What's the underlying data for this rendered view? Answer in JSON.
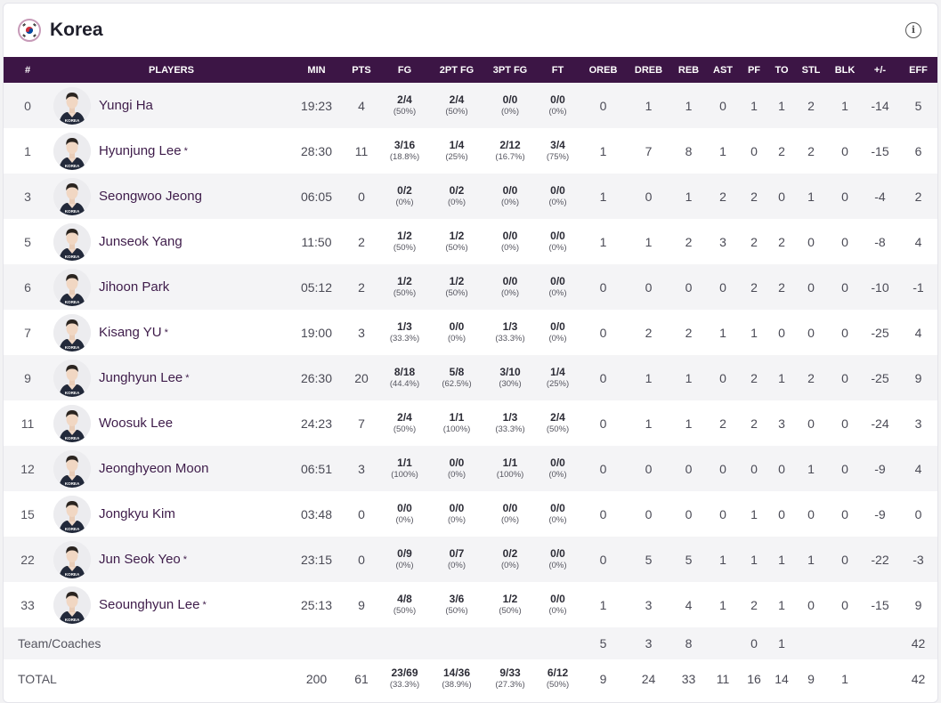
{
  "team": {
    "name": "Korea",
    "flag_icon": "south-korea-flag-icon",
    "info_icon": "info-icon"
  },
  "colors": {
    "header_bg": "#3c1545",
    "player_name": "#3e1c4a",
    "row_alt": "#f4f4f6"
  },
  "columns": [
    "#",
    "PLAYERS",
    "MIN",
    "PTS",
    "FG",
    "2PT FG",
    "3PT FG",
    "FT",
    "OREB",
    "DREB",
    "REB",
    "AST",
    "PF",
    "TO",
    "STL",
    "BLK",
    "+/-",
    "EFF"
  ],
  "players": [
    {
      "num": "0",
      "name": "Yungi Ha",
      "starter": false,
      "min": "19:23",
      "pts": "4",
      "fg": "2/4",
      "fg_pct": "(50%)",
      "p2": "2/4",
      "p2_pct": "(50%)",
      "p3": "0/0",
      "p3_pct": "(0%)",
      "ft": "0/0",
      "ft_pct": "(0%)",
      "oreb": "0",
      "dreb": "1",
      "reb": "1",
      "ast": "0",
      "pf": "1",
      "to": "1",
      "stl": "2",
      "blk": "1",
      "pm": "-14",
      "eff": "5"
    },
    {
      "num": "1",
      "name": "Hyunjung Lee",
      "starter": true,
      "min": "28:30",
      "pts": "11",
      "fg": "3/16",
      "fg_pct": "(18.8%)",
      "p2": "1/4",
      "p2_pct": "(25%)",
      "p3": "2/12",
      "p3_pct": "(16.7%)",
      "ft": "3/4",
      "ft_pct": "(75%)",
      "oreb": "1",
      "dreb": "7",
      "reb": "8",
      "ast": "1",
      "pf": "0",
      "to": "2",
      "stl": "2",
      "blk": "0",
      "pm": "-15",
      "eff": "6"
    },
    {
      "num": "3",
      "name": "Seongwoo Jeong",
      "starter": false,
      "min": "06:05",
      "pts": "0",
      "fg": "0/2",
      "fg_pct": "(0%)",
      "p2": "0/2",
      "p2_pct": "(0%)",
      "p3": "0/0",
      "p3_pct": "(0%)",
      "ft": "0/0",
      "ft_pct": "(0%)",
      "oreb": "1",
      "dreb": "0",
      "reb": "1",
      "ast": "2",
      "pf": "2",
      "to": "0",
      "stl": "1",
      "blk": "0",
      "pm": "-4",
      "eff": "2"
    },
    {
      "num": "5",
      "name": "Junseok Yang",
      "starter": false,
      "min": "11:50",
      "pts": "2",
      "fg": "1/2",
      "fg_pct": "(50%)",
      "p2": "1/2",
      "p2_pct": "(50%)",
      "p3": "0/0",
      "p3_pct": "(0%)",
      "ft": "0/0",
      "ft_pct": "(0%)",
      "oreb": "1",
      "dreb": "1",
      "reb": "2",
      "ast": "3",
      "pf": "2",
      "to": "2",
      "stl": "0",
      "blk": "0",
      "pm": "-8",
      "eff": "4"
    },
    {
      "num": "6",
      "name": "Jihoon Park",
      "starter": false,
      "min": "05:12",
      "pts": "2",
      "fg": "1/2",
      "fg_pct": "(50%)",
      "p2": "1/2",
      "p2_pct": "(50%)",
      "p3": "0/0",
      "p3_pct": "(0%)",
      "ft": "0/0",
      "ft_pct": "(0%)",
      "oreb": "0",
      "dreb": "0",
      "reb": "0",
      "ast": "0",
      "pf": "2",
      "to": "2",
      "stl": "0",
      "blk": "0",
      "pm": "-10",
      "eff": "-1"
    },
    {
      "num": "7",
      "name": "Kisang YU",
      "starter": true,
      "min": "19:00",
      "pts": "3",
      "fg": "1/3",
      "fg_pct": "(33.3%)",
      "p2": "0/0",
      "p2_pct": "(0%)",
      "p3": "1/3",
      "p3_pct": "(33.3%)",
      "ft": "0/0",
      "ft_pct": "(0%)",
      "oreb": "0",
      "dreb": "2",
      "reb": "2",
      "ast": "1",
      "pf": "1",
      "to": "0",
      "stl": "0",
      "blk": "0",
      "pm": "-25",
      "eff": "4"
    },
    {
      "num": "9",
      "name": "Junghyun Lee",
      "starter": true,
      "min": "26:30",
      "pts": "20",
      "fg": "8/18",
      "fg_pct": "(44.4%)",
      "p2": "5/8",
      "p2_pct": "(62.5%)",
      "p3": "3/10",
      "p3_pct": "(30%)",
      "ft": "1/4",
      "ft_pct": "(25%)",
      "oreb": "0",
      "dreb": "1",
      "reb": "1",
      "ast": "0",
      "pf": "2",
      "to": "1",
      "stl": "2",
      "blk": "0",
      "pm": "-25",
      "eff": "9"
    },
    {
      "num": "11",
      "name": "Woosuk Lee",
      "starter": false,
      "min": "24:23",
      "pts": "7",
      "fg": "2/4",
      "fg_pct": "(50%)",
      "p2": "1/1",
      "p2_pct": "(100%)",
      "p3": "1/3",
      "p3_pct": "(33.3%)",
      "ft": "2/4",
      "ft_pct": "(50%)",
      "oreb": "0",
      "dreb": "1",
      "reb": "1",
      "ast": "2",
      "pf": "2",
      "to": "3",
      "stl": "0",
      "blk": "0",
      "pm": "-24",
      "eff": "3"
    },
    {
      "num": "12",
      "name": "Jeonghyeon Moon",
      "starter": false,
      "min": "06:51",
      "pts": "3",
      "fg": "1/1",
      "fg_pct": "(100%)",
      "p2": "0/0",
      "p2_pct": "(0%)",
      "p3": "1/1",
      "p3_pct": "(100%)",
      "ft": "0/0",
      "ft_pct": "(0%)",
      "oreb": "0",
      "dreb": "0",
      "reb": "0",
      "ast": "0",
      "pf": "0",
      "to": "0",
      "stl": "1",
      "blk": "0",
      "pm": "-9",
      "eff": "4"
    },
    {
      "num": "15",
      "name": "Jongkyu Kim",
      "starter": false,
      "min": "03:48",
      "pts": "0",
      "fg": "0/0",
      "fg_pct": "(0%)",
      "p2": "0/0",
      "p2_pct": "(0%)",
      "p3": "0/0",
      "p3_pct": "(0%)",
      "ft": "0/0",
      "ft_pct": "(0%)",
      "oreb": "0",
      "dreb": "0",
      "reb": "0",
      "ast": "0",
      "pf": "1",
      "to": "0",
      "stl": "0",
      "blk": "0",
      "pm": "-9",
      "eff": "0"
    },
    {
      "num": "22",
      "name": "Jun Seok Yeo",
      "starter": true,
      "min": "23:15",
      "pts": "0",
      "fg": "0/9",
      "fg_pct": "(0%)",
      "p2": "0/7",
      "p2_pct": "(0%)",
      "p3": "0/2",
      "p3_pct": "(0%)",
      "ft": "0/0",
      "ft_pct": "(0%)",
      "oreb": "0",
      "dreb": "5",
      "reb": "5",
      "ast": "1",
      "pf": "1",
      "to": "1",
      "stl": "1",
      "blk": "0",
      "pm": "-22",
      "eff": "-3"
    },
    {
      "num": "33",
      "name": "Seounghyun Lee",
      "starter": true,
      "min": "25:13",
      "pts": "9",
      "fg": "4/8",
      "fg_pct": "(50%)",
      "p2": "3/6",
      "p2_pct": "(50%)",
      "p3": "1/2",
      "p3_pct": "(50%)",
      "ft": "0/0",
      "ft_pct": "(0%)",
      "oreb": "1",
      "dreb": "3",
      "reb": "4",
      "ast": "1",
      "pf": "2",
      "to": "1",
      "stl": "0",
      "blk": "0",
      "pm": "-15",
      "eff": "9"
    }
  ],
  "team_coaches": {
    "label": "Team/Coaches",
    "oreb": "5",
    "dreb": "3",
    "reb": "8",
    "ast": "",
    "pf": "0",
    "to": "1",
    "stl": "",
    "blk": "",
    "pm": "",
    "eff": "42"
  },
  "total": {
    "label": "TOTAL",
    "min": "200",
    "pts": "61",
    "fg": "23/69",
    "fg_pct": "(33.3%)",
    "p2": "14/36",
    "p2_pct": "(38.9%)",
    "p3": "9/33",
    "p3_pct": "(27.3%)",
    "ft": "6/12",
    "ft_pct": "(50%)",
    "oreb": "9",
    "dreb": "24",
    "reb": "33",
    "ast": "11",
    "pf": "16",
    "to": "14",
    "stl": "9",
    "blk": "1",
    "pm": "",
    "eff": "42"
  },
  "starter_mark": "*",
  "jersey_text": "KOREA"
}
